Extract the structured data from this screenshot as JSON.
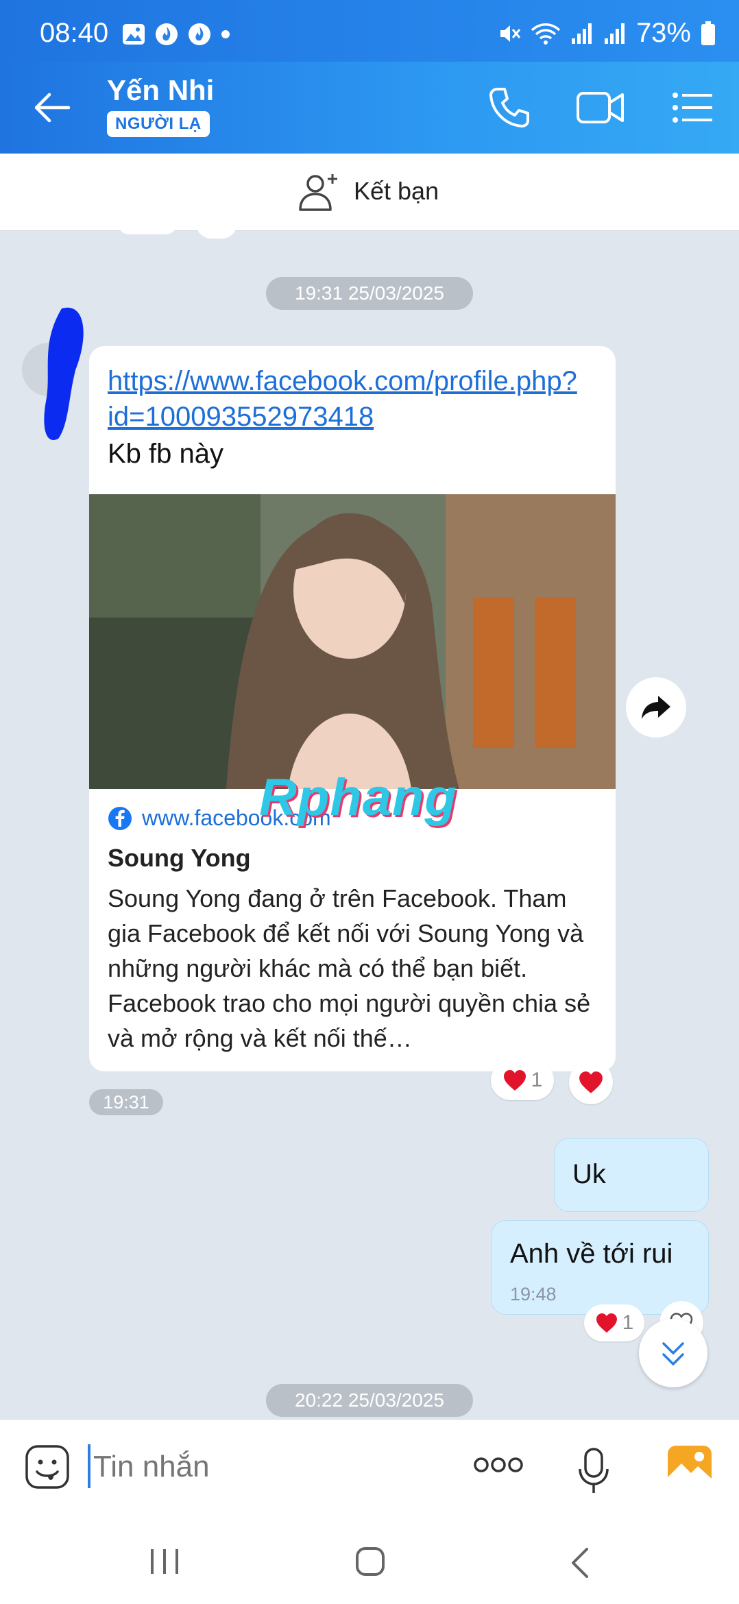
{
  "status_bar": {
    "time": "08:40",
    "battery": "73%"
  },
  "header": {
    "contact_name": "Yến Nhi",
    "contact_badge": "NGƯỜI LẠ"
  },
  "add_friend": {
    "label": "Kết bạn"
  },
  "chat": {
    "date_separator_1": "19:31 25/03/2025",
    "incoming": {
      "link_text": "https://www.facebook.com/profile.php?id=100093552973418",
      "message_text": "Kb fb này",
      "preview": {
        "domain": "www.facebook.com",
        "title": "Soung Yong",
        "description": "Soung Yong đang ở trên Facebook. Tham gia Facebook để kết nối với Soung Yong và những người khác mà có thể bạn biết. Facebook trao cho mọi người quyền chia sẻ và mở rộng và kết nối thế…"
      },
      "reaction_count": "1",
      "time": "19:31"
    },
    "outgoing_1": {
      "text": "Uk"
    },
    "outgoing_2": {
      "text": "Anh về tới rui",
      "time": "19:48",
      "reaction_count": "1"
    },
    "date_separator_2": "20:22 25/03/2025"
  },
  "watermark": "Rphang",
  "composer": {
    "placeholder": "Tin nhắn"
  },
  "colors": {
    "accent": "#1f74e0",
    "link": "#1d6fd8",
    "outgoing_bubble": "#d5efff",
    "chat_bg": "#dfe6ee"
  }
}
